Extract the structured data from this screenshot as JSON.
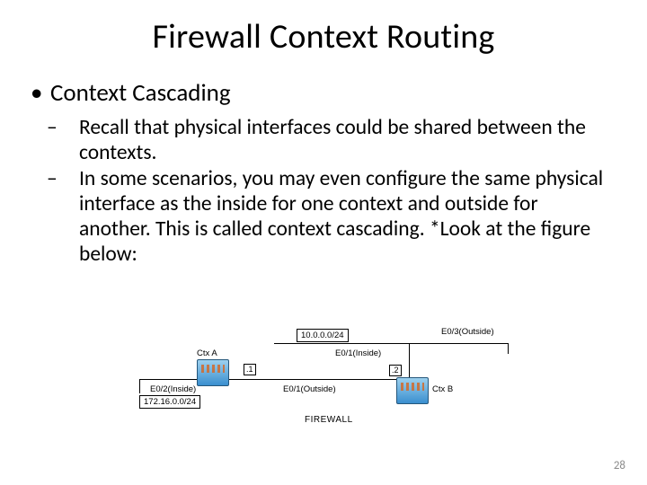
{
  "title": "Firewall Context Routing",
  "bullets": {
    "l1": "Context Cascading",
    "l2a": "Recall that physical interfaces could be shared between the contexts.",
    "l2b": "In some scenarios, you may even configure the same physical interface as the inside for one context and outside for another. This is called context cascading. *Look at the figure below:"
  },
  "diagram": {
    "ctxA": "Ctx A",
    "ctxB": "Ctx B",
    "e02": "E0/2(Inside)",
    "e01_out": "E0/1(Outside)",
    "e01_in": "E0/1(Inside)",
    "e03": "E0/3(Outside)",
    "net_left": "172.16.0.0/24",
    "net_top": "10.0.0.0/24",
    "hop1": ".1",
    "hop2": ".2",
    "firewall": "FIREWALL"
  },
  "page": "28"
}
